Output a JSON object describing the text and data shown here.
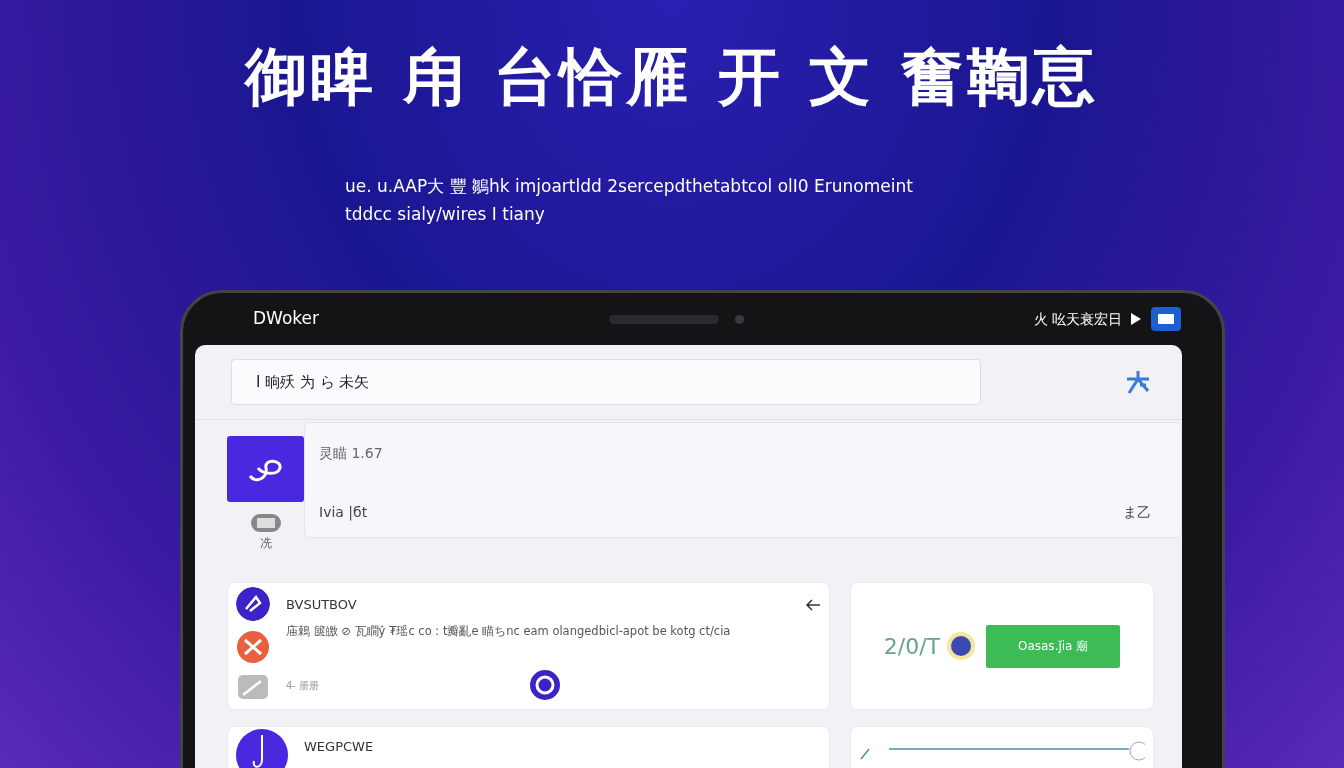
{
  "headline": "御睥 甪 台恰雁 开 文 奮鞫恴",
  "subtitle_lines": [
    "ue. u.AAP大 豐 鶵hk imjoartldd 2sercepdthetabtcol olI0 Erunomeint",
    "tddcc sialy/wires I tiany"
  ],
  "device": {
    "app_name": "DWoker",
    "status_text": "火 吆天衰宏日"
  },
  "search": {
    "value": "I 晌殀 为 ら 未矢"
  },
  "profile": {
    "title": "灵瞄 1.67",
    "subtitle": "Ivia |бt",
    "trailing": "ま乙",
    "caption": "冼"
  },
  "feed_card": {
    "title": "BVSUTBOV",
    "body": "庙鵣 篋皦 ⊘ 瓦瞯ŷ ₮瑶c co : t瓣亂e 瞄ちnc eam olangedbicl-apot be kotg ct/cia",
    "footer": "4- 册册"
  },
  "stat_card": {
    "value": "2/0/T",
    "button": "Oasas.ǰia 廟"
  },
  "second_card": {
    "title": "WEGPCWE"
  }
}
